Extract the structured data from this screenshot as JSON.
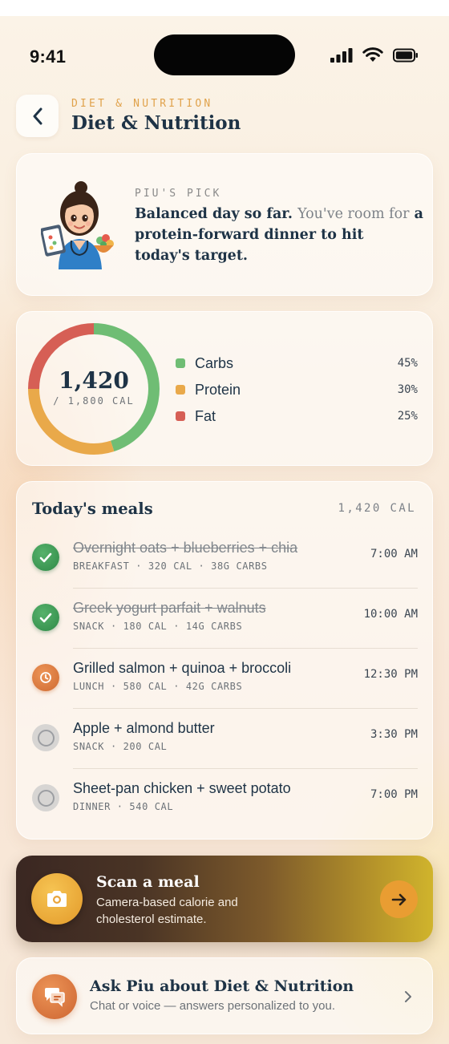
{
  "status_bar": {
    "time": "9:41"
  },
  "header": {
    "eyebrow": "DIET & NUTRITION",
    "title": "Diet & Nutrition"
  },
  "pick": {
    "label": "PIU'S PICK",
    "text_strong": "Balanced day so far.",
    "text_soft": "You've room for",
    "text_rest": "a protein-forward dinner to hit today's target."
  },
  "summary": {
    "calories": "1,420",
    "target": "/ 1,800 CAL",
    "macros": [
      {
        "name": "Carbs",
        "percent": "45%",
        "value": 45,
        "color": "#6fbd74"
      },
      {
        "name": "Protein",
        "percent": "30%",
        "value": 30,
        "color": "#e9a94a"
      },
      {
        "name": "Fat",
        "percent": "25%",
        "value": 25,
        "color": "#d65f55"
      }
    ]
  },
  "meals": {
    "title": "Today's meals",
    "total": "1,420 CAL",
    "items": [
      {
        "name": "Overnight oats + blueberries + chia",
        "meta": "BREAKFAST · 320 CAL · 38G CARBS",
        "time": "7:00 AM",
        "status": "done"
      },
      {
        "name": "Greek yogurt parfait + walnuts",
        "meta": "SNACK · 180 CAL · 14G CARBS",
        "time": "10:00 AM",
        "status": "done"
      },
      {
        "name": "Grilled salmon + quinoa + broccoli",
        "meta": "LUNCH · 580 CAL · 42G CARBS",
        "time": "12:30 PM",
        "status": "now"
      },
      {
        "name": "Apple + almond butter",
        "meta": "SNACK · 200 CAL",
        "time": "3:30 PM",
        "status": "todo"
      },
      {
        "name": "Sheet-pan chicken + sweet potato",
        "meta": "DINNER · 540 CAL",
        "time": "7:00 PM",
        "status": "todo"
      }
    ]
  },
  "scan": {
    "title": "Scan a meal",
    "subtitle": "Camera-based calorie and cholesterol estimate."
  },
  "ask": {
    "title": "Ask Piu about Diet & Nutrition",
    "subtitle": "Chat or voice — answers personalized to you."
  },
  "icons": {
    "back": "chevron-left-icon",
    "camera": "camera-icon",
    "arrow": "arrow-right-icon",
    "chat": "chat-bubbles-icon",
    "chevron": "chevron-right-icon",
    "done": "check-icon",
    "now": "clock-icon",
    "todo": "empty-circle-icon"
  }
}
